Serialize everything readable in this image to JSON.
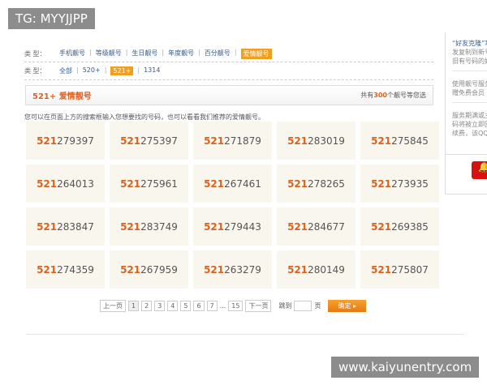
{
  "watermarks": [
    "TG: MYYJJPP",
    "www.kaiyunentry.com"
  ],
  "filter_type": {
    "label": "类  型：",
    "options": [
      "手机靓号",
      "等级靓号",
      "生日靓号",
      "年度靓号",
      "百分靓号",
      "爱情靓号"
    ],
    "selected": "爱情靓号"
  },
  "filter_sub": {
    "label": "类  型：",
    "options": [
      "全部",
      "520+",
      "521+",
      "1314"
    ],
    "selected": "521+"
  },
  "section": {
    "title": "521+ 爱情靓号",
    "count_prefix": "共有",
    "count": "300",
    "count_suffix": "个靓号等您选"
  },
  "tip": "您可以在页面上方的搜索框输入您想要找的号码，也可以看看我们推荐的爱情靓号。",
  "numbers": [
    {
      "prefix": "521",
      "rest": "279397"
    },
    {
      "prefix": "521",
      "rest": "275397"
    },
    {
      "prefix": "521",
      "rest": "271879"
    },
    {
      "prefix": "521",
      "rest": "283019"
    },
    {
      "prefix": "521",
      "rest": "275845"
    },
    {
      "prefix": "521",
      "rest": "264013"
    },
    {
      "prefix": "521",
      "rest": "275961"
    },
    {
      "prefix": "521",
      "rest": "267461"
    },
    {
      "prefix": "521",
      "rest": "278265"
    },
    {
      "prefix": "521",
      "rest": "273935"
    },
    {
      "prefix": "521",
      "rest": "283847"
    },
    {
      "prefix": "521",
      "rest": "283749"
    },
    {
      "prefix": "521",
      "rest": "279443"
    },
    {
      "prefix": "521",
      "rest": "284677"
    },
    {
      "prefix": "521",
      "rest": "269385"
    },
    {
      "prefix": "521",
      "rest": "274359"
    },
    {
      "prefix": "521",
      "rest": "267959"
    },
    {
      "prefix": "521",
      "rest": "263279"
    },
    {
      "prefix": "521",
      "rest": "280149"
    },
    {
      "prefix": "521",
      "rest": "275807"
    }
  ],
  "pager": {
    "prev": "上一页",
    "pages": [
      "1",
      "2",
      "3",
      "4",
      "5",
      "6",
      "7"
    ],
    "ellipsis": "...",
    "last": "15",
    "next": "下一页",
    "current": "1",
    "jump_label": "跳到",
    "jump_value": "",
    "page_unit": "页",
    "ok": "确定 ▸"
  },
  "sidebar": {
    "p1_head": "“好友克隆”功",
    "p1": [
      "发复制到新号",
      "旧有号码的好"
    ],
    "p2": [
      "使用靓号服务",
      "赠免费会员"
    ],
    "p3": [
      "服务期满或主",
      "码将被立即回",
      "续费，该QQ"
    ]
  },
  "colors": {
    "accent": "#f0a020",
    "number_prefix": "#d9621e"
  }
}
